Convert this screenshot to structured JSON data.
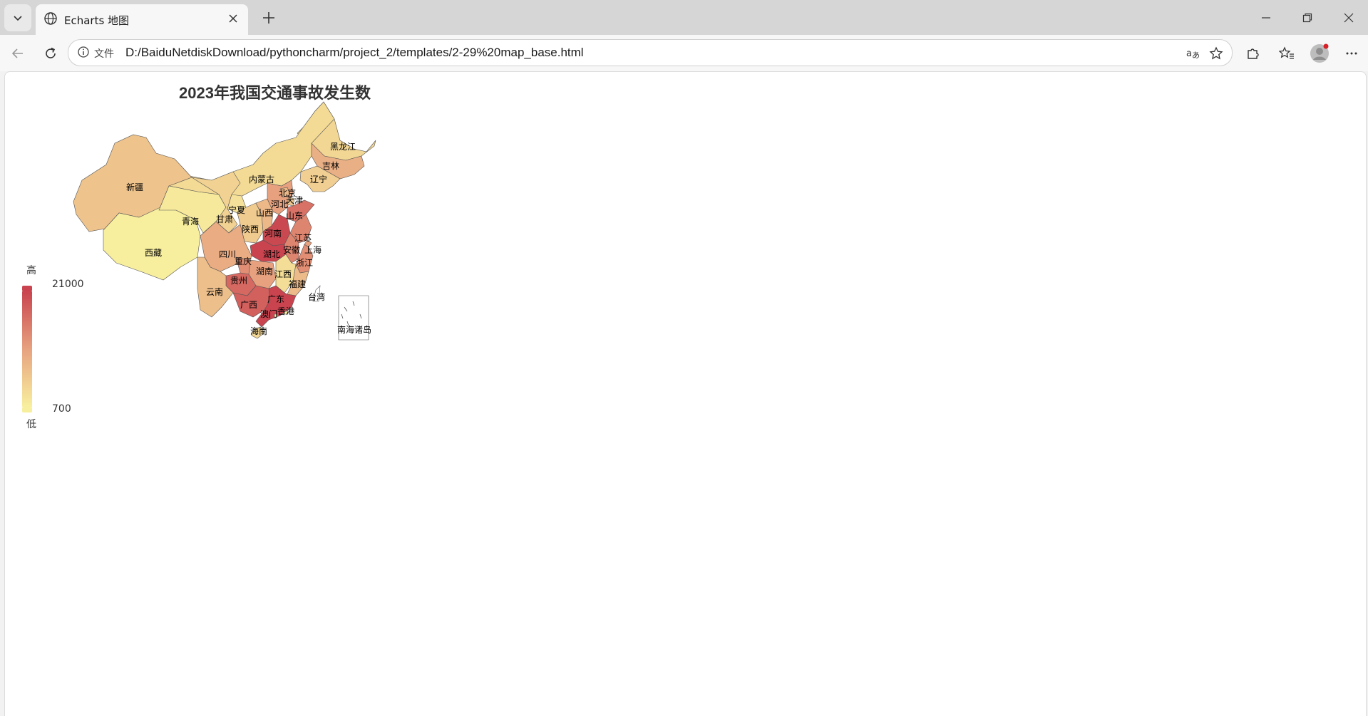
{
  "browser": {
    "tab_title": "Echarts 地图",
    "address_prefix": "文件",
    "url": "D:/BaiduNetdiskDownload/pythoncharm/project_2/templates/2-29%20map_base.html"
  },
  "chart_data": {
    "type": "map",
    "title": "2023年我国交通事故发生数",
    "visual_map": {
      "min": 700,
      "max": 21000,
      "text_high": "高",
      "text_low": "低",
      "color_low": "#f8ef9e",
      "color_mid": "#e7a27f",
      "color_high": "#c9444f"
    },
    "regions": [
      {
        "name": "黑龙江",
        "value": 4000
      },
      {
        "name": "吉林",
        "value": 9000
      },
      {
        "name": "辽宁",
        "value": 5000
      },
      {
        "name": "内蒙古",
        "value": 3500
      },
      {
        "name": "新疆",
        "value": 6500
      },
      {
        "name": "西藏",
        "value": 700
      },
      {
        "name": "青海",
        "value": 1500
      },
      {
        "name": "甘肃",
        "value": 4500
      },
      {
        "name": "宁夏",
        "value": 2500
      },
      {
        "name": "陕西",
        "value": 5500
      },
      {
        "name": "山西",
        "value": 8000
      },
      {
        "name": "河北",
        "value": 11000
      },
      {
        "name": "北京",
        "value": 8000
      },
      {
        "name": "天津",
        "value": 6000
      },
      {
        "name": "山东",
        "value": 16000
      },
      {
        "name": "河南",
        "value": 20500
      },
      {
        "name": "江苏",
        "value": 14000
      },
      {
        "name": "安徽",
        "value": 14000
      },
      {
        "name": "上海",
        "value": 11000
      },
      {
        "name": "浙江",
        "value": 13000
      },
      {
        "name": "湖北",
        "value": 21000
      },
      {
        "name": "湖南",
        "value": 11000
      },
      {
        "name": "江西",
        "value": 3000
      },
      {
        "name": "福建",
        "value": 7500
      },
      {
        "name": "四川",
        "value": 9500
      },
      {
        "name": "重庆",
        "value": 13000
      },
      {
        "name": "贵州",
        "value": 17000
      },
      {
        "name": "云南",
        "value": 7000
      },
      {
        "name": "广西",
        "value": 18000
      },
      {
        "name": "广东",
        "value": 21000
      },
      {
        "name": "海南",
        "value": 4000
      },
      {
        "name": "澳门",
        "value": 900
      },
      {
        "name": "香港",
        "value": 900
      },
      {
        "name": "台湾",
        "value": 0
      },
      {
        "name": "南海诸岛",
        "value": 0
      }
    ]
  }
}
